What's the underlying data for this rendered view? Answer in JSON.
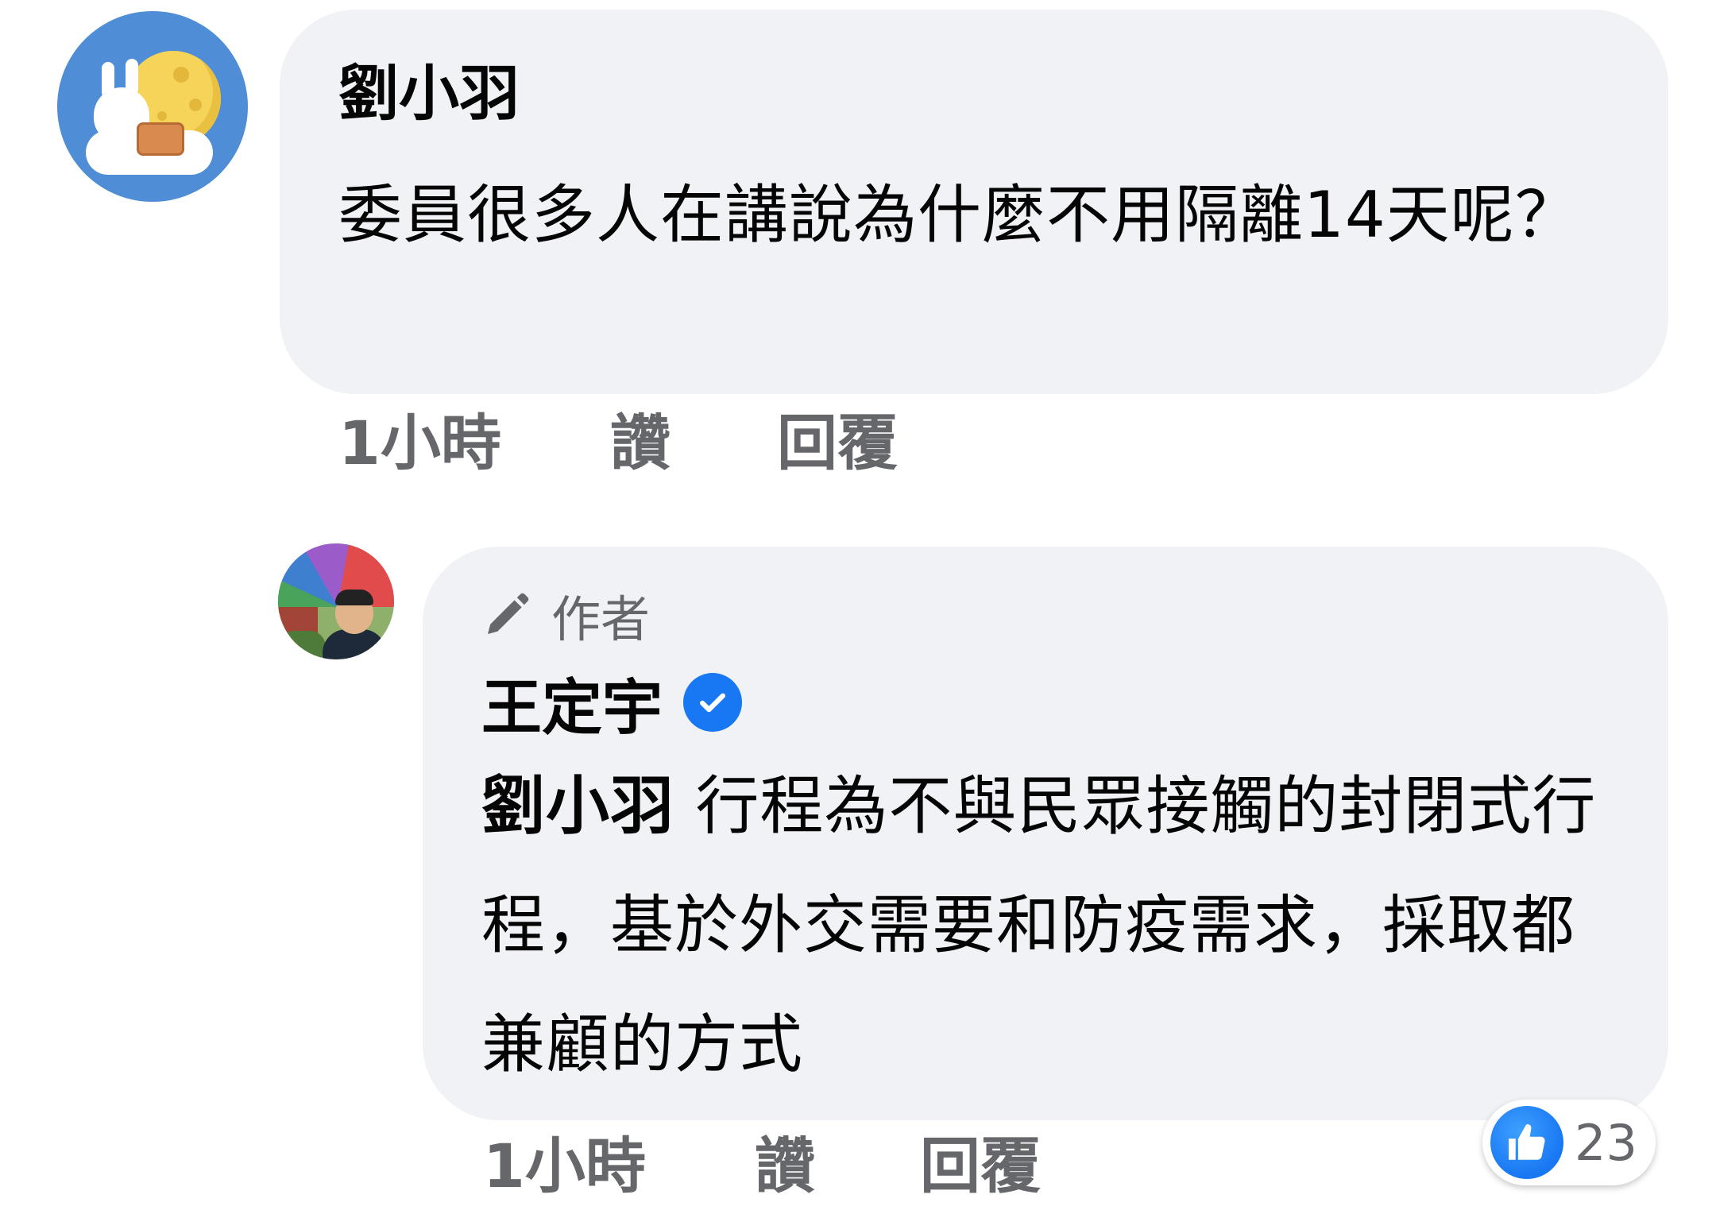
{
  "comment": {
    "author": "劉小羽",
    "text": "委員很多人在講說為什麼不用隔離14天呢？",
    "time": "1小時",
    "like_label": "讚",
    "reply_label": "回覆"
  },
  "reply": {
    "author_badge": "作者",
    "author": "王定宇",
    "verified": true,
    "mention": "劉小羽",
    "text": "行程為不與民眾接觸的封閉式行程，基於外交需要和防疫需求，採取都兼顧的方式",
    "time": "1小時",
    "like_label": "讚",
    "reply_label": "回覆",
    "reaction_count": "23"
  },
  "icons": {
    "author_badge": "pencil-icon",
    "verified": "verified-check-icon",
    "reaction": "thumbs-up-icon"
  },
  "colors": {
    "bubble": "#f0f2f5",
    "meta_text": "#65676b",
    "facebook_blue": "#1877f2"
  }
}
